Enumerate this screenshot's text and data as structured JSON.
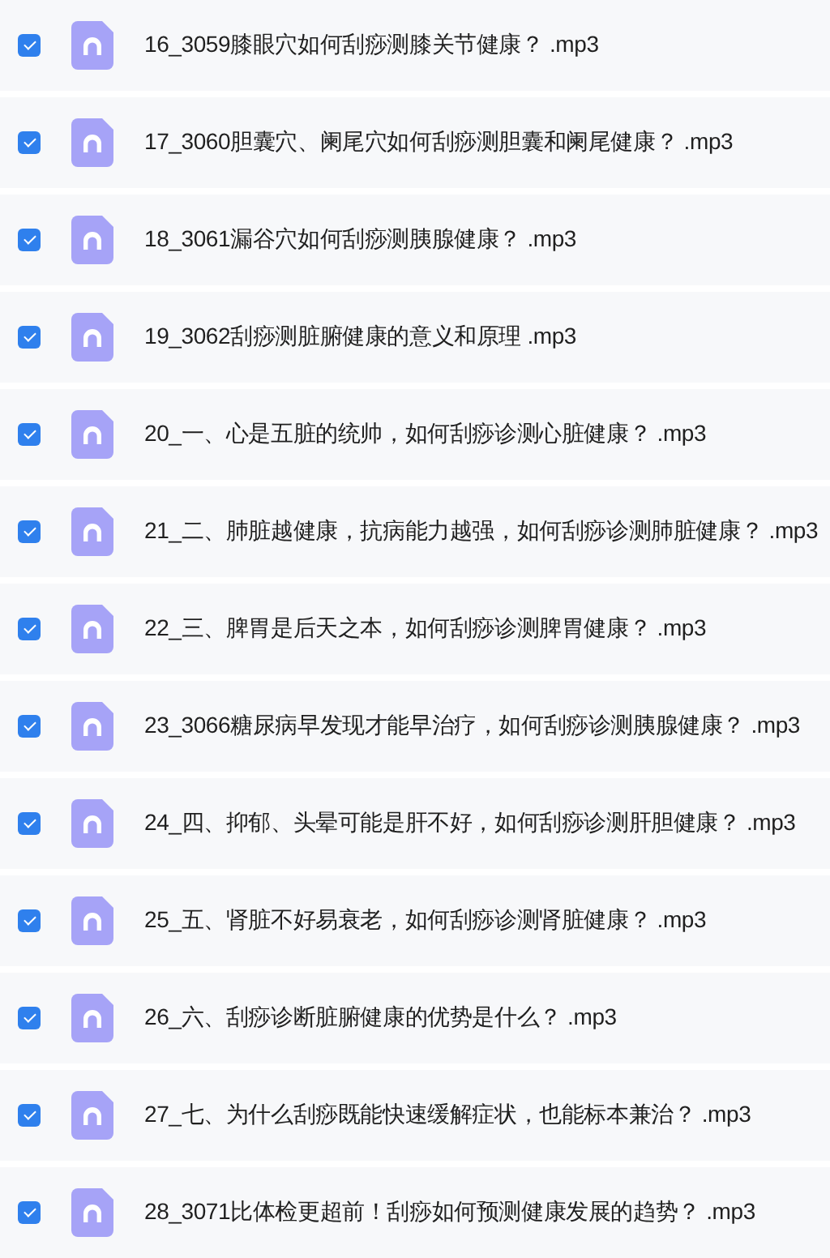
{
  "files": [
    {
      "name": "16_3059膝眼穴如何刮痧测膝关节健康？ .mp3",
      "checked": true
    },
    {
      "name": "17_3060胆囊穴、阑尾穴如何刮痧测胆囊和阑尾健康？ .mp3",
      "checked": true
    },
    {
      "name": "18_3061漏谷穴如何刮痧测胰腺健康？ .mp3",
      "checked": true
    },
    {
      "name": "19_3062刮痧测脏腑健康的意义和原理 .mp3",
      "checked": true
    },
    {
      "name": "20_一、心是五脏的统帅，如何刮痧诊测心脏健康？ .mp3",
      "checked": true
    },
    {
      "name": "21_二、肺脏越健康，抗病能力越强，如何刮痧诊测肺脏健康？ .mp3",
      "checked": true
    },
    {
      "name": "22_三、脾胃是后天之本，如何刮痧诊测脾胃健康？ .mp3",
      "checked": true
    },
    {
      "name": "23_3066糖尿病早发现才能早治疗，如何刮痧诊测胰腺健康？ .mp3",
      "checked": true
    },
    {
      "name": "24_四、抑郁、头晕可能是肝不好，如何刮痧诊测肝胆健康？ .mp3",
      "checked": true
    },
    {
      "name": "25_五、肾脏不好易衰老，如何刮痧诊测肾脏健康？ .mp3",
      "checked": true
    },
    {
      "name": "26_六、刮痧诊断脏腑健康的优势是什么？ .mp3",
      "checked": true
    },
    {
      "name": "27_七、为什么刮痧既能快速缓解症状，也能标本兼治？ .mp3",
      "checked": true
    },
    {
      "name": "28_3071比体检更超前！刮痧如何预测健康发展的趋势？ .mp3",
      "checked": true
    }
  ]
}
